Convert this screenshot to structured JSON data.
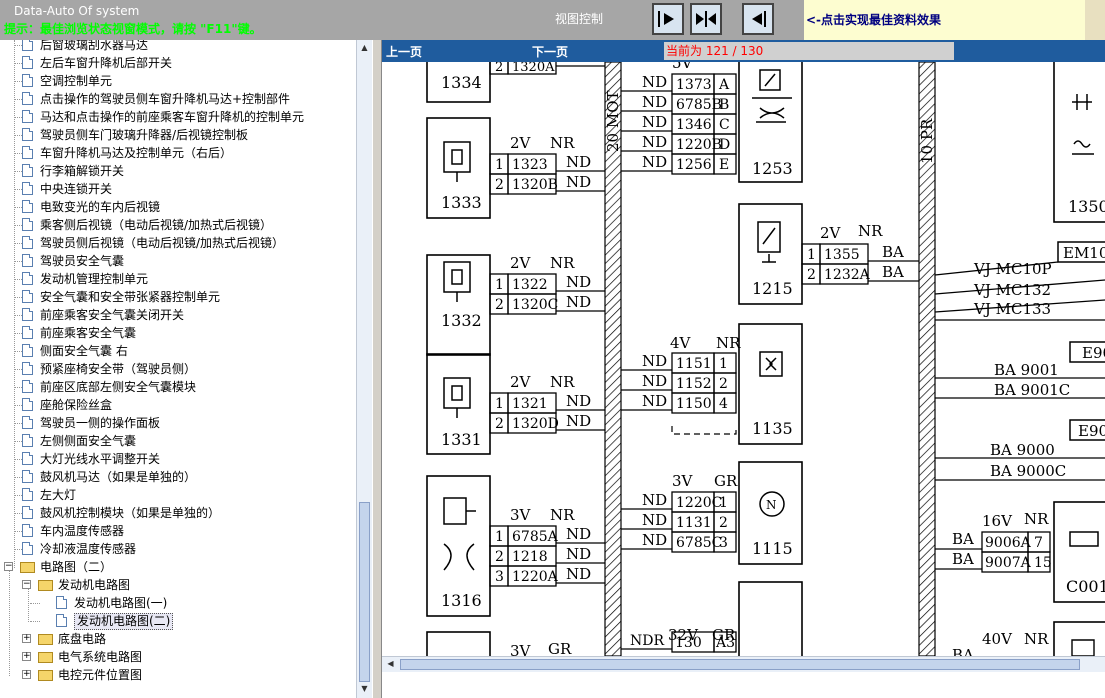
{
  "app_title": "Data-Auto Of system",
  "hint": "提示：最佳浏览状态视窗模式，请按 \"F11\"键。",
  "view_control_label": "视图控制",
  "best_effect_text": "<-点击实现最佳资料效果",
  "nav": {
    "prev": "上一页",
    "next": "下一页",
    "current_page": "当前为  121 / 130"
  },
  "tree": {
    "items": [
      "后窗玻璃刮水器马达",
      "左后车窗升降机后部开关",
      "空调控制单元",
      "点击操作的驾驶员侧车窗升降机马达+控制部件",
      "马达和点击操作的前座乘客车窗升降机的控制单元",
      "驾驶员侧车门玻璃升降器/后视镜控制板",
      "车窗升降机马达及控制单元（右后）",
      "行李箱解锁开关",
      "中央连锁开关",
      "电致变光的车内后视镜",
      "乘客侧后视镜（电动后视镜/加热式后视镜）",
      "驾驶员侧后视镜（电动后视镜/加热式后视镜）",
      "驾驶员安全气囊",
      "发动机管理控制单元",
      "安全气囊和安全带张紧器控制单元",
      "前座乘客安全气囊关闭开关",
      "前座乘客安全气囊",
      "侧面安全气囊 右",
      "预紧座椅安全带（驾驶员侧）",
      "前座区底部左侧安全气囊模块",
      "座舱保险丝盒",
      "驾驶员一侧的操作面板",
      "左侧侧面安全气囊",
      "大灯光线水平调整开关",
      "鼓风机马达（如果是单独的）",
      "左大灯",
      "鼓风机控制模块（如果是单独的）",
      "车内温度传感器",
      "冷却液温度传感器"
    ],
    "folder_root": "电路图（二）",
    "folder_engine": "发动机电路图",
    "engine_docs": [
      "发动机电路图(一)",
      "发动机电路图(二)"
    ],
    "other_folders": [
      "底盘电路",
      "电气系统电路图",
      "电控元件位置图"
    ]
  },
  "diagram": {
    "components": [
      "1334",
      "1333",
      "1332",
      "1331",
      "1316",
      "1253",
      "1215",
      "1135",
      "1115",
      "1350",
      "C001"
    ],
    "bus_labels": [
      "20 MOT",
      "10 PR"
    ],
    "connectors": {
      "c1333": {
        "head": [
          "2V",
          "NR"
        ],
        "rows": [
          [
            "1",
            "1323",
            "ND"
          ],
          [
            "2",
            "1320B",
            "ND"
          ]
        ]
      },
      "c1332": {
        "head": [
          "2V",
          "NR"
        ],
        "rows": [
          [
            "1",
            "1322",
            "ND"
          ],
          [
            "2",
            "1320C",
            "ND"
          ]
        ]
      },
      "c1331": {
        "head": [
          "2V",
          "NR"
        ],
        "rows": [
          [
            "1",
            "1321",
            "ND"
          ],
          [
            "2",
            "1320D",
            "ND"
          ]
        ]
      },
      "c1316": {
        "head": [
          "3V",
          "NR"
        ],
        "rows": [
          [
            "1",
            "6785A",
            "ND"
          ],
          [
            "2",
            "1218",
            "ND"
          ],
          [
            "3",
            "1220A",
            "ND"
          ]
        ]
      },
      "c1334": {
        "rows": [
          [
            "2",
            "1320A"
          ]
        ]
      },
      "c1253": {
        "head": [
          "5V"
        ],
        "rows": [
          [
            "ND",
            "1373",
            "A"
          ],
          [
            "ND",
            "6785B",
            "B"
          ],
          [
            "ND",
            "1346",
            "C"
          ],
          [
            "ND",
            "1220B",
            "D"
          ],
          [
            "ND",
            "1256",
            "E"
          ]
        ]
      },
      "c1215": {
        "head": [
          "2V",
          "NR"
        ],
        "rows": [
          [
            "1",
            "1355",
            "BA"
          ],
          [
            "2",
            "1232A",
            "BA"
          ]
        ]
      },
      "c1135": {
        "head": [
          "4V",
          "NR"
        ],
        "rows": [
          [
            "ND",
            "1151",
            "1"
          ],
          [
            "ND",
            "1152",
            "2"
          ],
          [
            "ND",
            "1150",
            "4"
          ]
        ]
      },
      "c1115": {
        "head": [
          "3V",
          "GR"
        ],
        "rows": [
          [
            "ND",
            "1220C",
            "1"
          ],
          [
            "ND",
            "1131",
            "2"
          ],
          [
            "ND",
            "6785C",
            "3"
          ]
        ]
      },
      "cbottom": {
        "head": [
          "32V",
          "GR"
        ],
        "rows": [
          [
            "NDR",
            "130",
            "A3"
          ]
        ]
      },
      "c1316b": {
        "head": [
          "3V",
          "GR"
        ]
      },
      "cC001": {
        "head": [
          "16V",
          "NR"
        ],
        "rows": [
          [
            "BA",
            "9006A",
            "7"
          ],
          [
            "BA",
            "9007A",
            "15"
          ]
        ]
      },
      "c40v": {
        "head": [
          "40V",
          "NR"
        ],
        "rows": [
          [
            "BA",
            "",
            ""
          ]
        ]
      }
    },
    "right_labels": [
      "EM10",
      "VJ  MC10P",
      "VJ  MC132",
      "VJ  MC133",
      "E90",
      "BA  9001",
      "BA  9001C",
      "E90",
      "BA  9000",
      "BA  9000C"
    ]
  }
}
